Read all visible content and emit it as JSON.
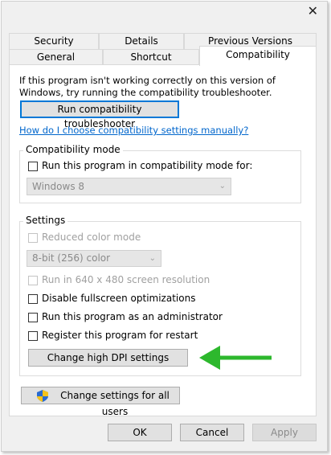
{
  "window": {
    "close_glyph": "✕"
  },
  "tabs": {
    "row1": [
      "Security",
      "Details",
      "Previous Versions"
    ],
    "row2": [
      "General",
      "Shortcut",
      "Compatibility"
    ],
    "active": "Compatibility"
  },
  "intro_text": "If this program isn't working correctly on this version of Windows, try running the compatibility troubleshooter.",
  "troubleshooter_button": "Run compatibility troubleshooter",
  "manual_link": "How do I choose compatibility settings manually?",
  "compat_mode": {
    "legend": "Compatibility mode",
    "checkbox_label": "Run this program in compatibility mode for:",
    "checked": false,
    "os_select_value": "Windows 8",
    "os_select_disabled": true
  },
  "settings": {
    "legend": "Settings",
    "reduced_color": {
      "label": "Reduced color mode",
      "checked": false,
      "disabled": true
    },
    "color_select_value": "8-bit (256) color",
    "run_640": {
      "label": "Run in 640 x 480 screen resolution",
      "checked": false,
      "disabled": true
    },
    "disable_fullscreen": {
      "label": "Disable fullscreen optimizations",
      "checked": false
    },
    "run_admin": {
      "label": "Run this program as an administrator",
      "checked": false
    },
    "register_restart": {
      "label": "Register this program for restart",
      "checked": false
    },
    "dpi_button": "Change high DPI settings"
  },
  "all_users_button": "Change settings for all users",
  "footer": {
    "ok": "OK",
    "cancel": "Cancel",
    "apply": "Apply"
  },
  "colors": {
    "accent": "#0078d7",
    "link": "#0066cc",
    "arrow": "#2db82d"
  }
}
